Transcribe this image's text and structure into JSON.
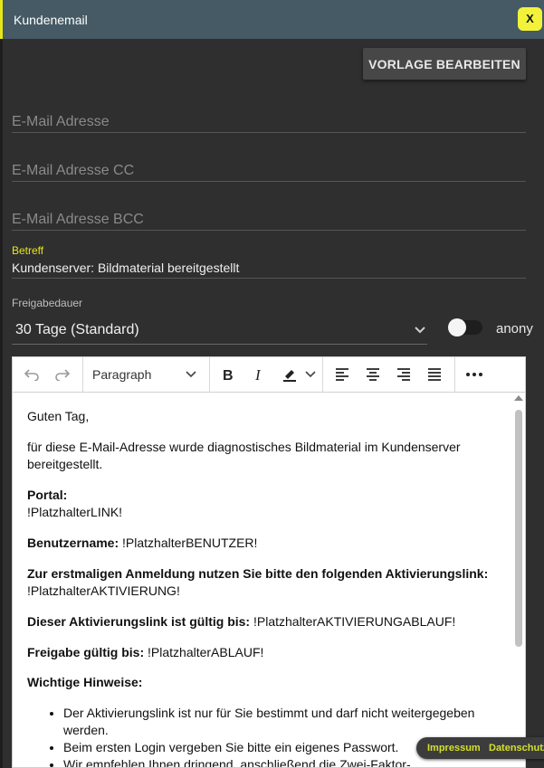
{
  "dialog": {
    "title": "Kundenemail",
    "close_label": "X"
  },
  "toolbar": {
    "vorlage_button": "VORLAGE BEARBEITEN"
  },
  "form": {
    "email_placeholder": "E-Mail Adresse",
    "cc_placeholder": "E-Mail Adresse CC",
    "bcc_placeholder": "E-Mail Adresse BCC",
    "betreff_label": "Betreff",
    "betreff_value": "Kundenserver: Bildmaterial bereitgestellt",
    "freigabe_label": "Freigabedauer",
    "freigabe_value": "30 Tage (Standard)",
    "anonym_label": "anony",
    "anonym_on": false
  },
  "editor_toolbar": {
    "block_format": "Paragraph",
    "icons": [
      "undo-icon",
      "redo-icon",
      "bold-icon",
      "italic-icon",
      "highlight-icon",
      "align-left-icon",
      "align-center-icon",
      "align-right-icon",
      "align-justify-icon",
      "more-icon"
    ]
  },
  "content": {
    "greeting": "Guten Tag,",
    "intro": "für diese E-Mail-Adresse wurde diagnostisches Bildmaterial im Kundenserver bereitgestellt.",
    "portal_label": "Portal:",
    "portal_value": "!PlatzhalterLINK!",
    "user_label": "Benutzername:",
    "user_value": " !PlatzhalterBENUTZER!",
    "activation_label": "Zur erstmaligen Anmeldung nutzen Sie bitte den folgenden Aktivierungslink:",
    "activation_value": "!PlatzhalterAKTIVIERUNG!",
    "valid_label": "Dieser Aktivierungslink ist gültig bis:",
    "valid_value": " !PlatzhalterAKTIVIERUNGABLAUF!",
    "release_label": "Freigabe gültig bis:",
    "release_value": " !PlatzhalterABLAUF!",
    "notes_label": "Wichtige Hinweise:",
    "notes": [
      "Der Aktivierungslink ist nur für Sie bestimmt und darf nicht weitergegeben werden.",
      "Beim ersten Login vergeben Sie bitte ein eigenes Passwort.",
      "Wir empfehlen Ihnen dringend, anschließend die Zwei-Faktor-"
    ]
  },
  "footer": {
    "impressum": "Impressum",
    "datenschutz": "Datenschutz"
  },
  "colors": {
    "accent": "#e6e619",
    "titlebar": "#455a64",
    "panel": "#2f2f2f"
  }
}
